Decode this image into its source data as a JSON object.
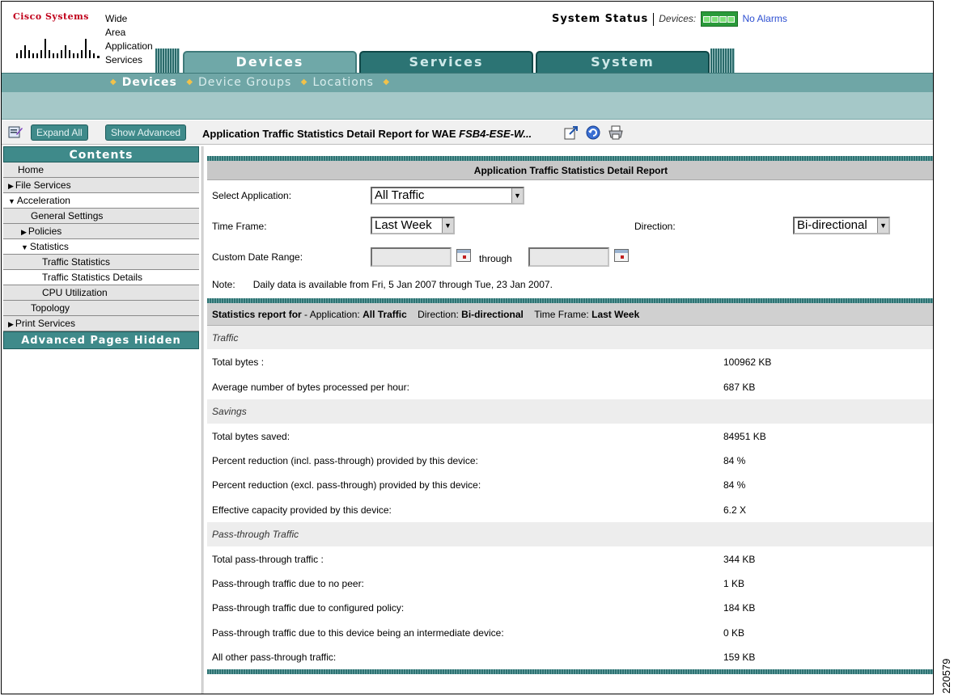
{
  "header": {
    "company": "Cisco Systems",
    "product_lines": [
      "Wide",
      "Area",
      "Application",
      "Services"
    ],
    "system_status_label": "System Status",
    "devices_label": "Devices:",
    "alarms_label": "No Alarms",
    "led_color": "#2a9a3a"
  },
  "tabs": [
    {
      "label": "Devices",
      "active": true
    },
    {
      "label": "Services",
      "active": false
    },
    {
      "label": "System",
      "active": false
    }
  ],
  "subnav": {
    "items": [
      "Devices",
      "Device Groups",
      "Locations"
    ],
    "current": "Devices"
  },
  "toolbar": {
    "expand_all": "Expand All",
    "show_advanced": "Show Advanced",
    "report_title_prefix": "Application Traffic Statistics Detail Report for WAE",
    "report_title_device": "FSB4-ESE-W..."
  },
  "leftnav": {
    "contents": "Contents",
    "items": [
      {
        "label": "Home",
        "indent": 0,
        "tri": "",
        "highlight": false
      },
      {
        "label": "File Services",
        "indent": 0,
        "tri": "▶",
        "highlight": false
      },
      {
        "label": "Acceleration",
        "indent": 0,
        "tri": "▼",
        "highlight": true
      },
      {
        "label": "General Settings",
        "indent": 1,
        "tri": "",
        "highlight": false
      },
      {
        "label": "Policies",
        "indent": 1,
        "tri": "▶",
        "highlight": false
      },
      {
        "label": "Statistics",
        "indent": 1,
        "tri": "▼",
        "highlight": true
      },
      {
        "label": "Traffic Statistics",
        "indent": 2,
        "tri": "",
        "highlight": false
      },
      {
        "label": "Traffic Statistics Details",
        "indent": 2,
        "tri": "",
        "highlight": true
      },
      {
        "label": "CPU Utilization",
        "indent": 2,
        "tri": "",
        "highlight": false
      },
      {
        "label": "Topology",
        "indent": 1,
        "tri": "",
        "highlight": false
      },
      {
        "label": "Print Services",
        "indent": 0,
        "tri": "▶",
        "highlight": false
      }
    ],
    "advanced_hidden": "Advanced Pages Hidden"
  },
  "report": {
    "section_title": "Application Traffic Statistics Detail Report",
    "select_application_label": "Select Application:",
    "select_application_value": "All Traffic",
    "time_frame_label": "Time Frame:",
    "time_frame_value": "Last Week",
    "direction_label": "Direction:",
    "direction_value": "Bi-directional",
    "custom_range_label": "Custom Date Range:",
    "through_label": "through",
    "note_label": "Note:",
    "note_text": "Daily data is available from Fri, 5 Jan 2007 through Tue, 23 Jan 2007."
  },
  "stats": {
    "header_prefix": "Statistics report for",
    "app_label": "- Application:",
    "app_value": "All Traffic",
    "dir_label": "Direction:",
    "dir_value": "Bi-directional",
    "tf_label": "Time Frame:",
    "tf_value": "Last Week",
    "rows": [
      {
        "type": "cat",
        "label": "Traffic",
        "value": ""
      },
      {
        "type": "row",
        "label": "Total bytes :",
        "value": "100962 KB"
      },
      {
        "type": "row",
        "label": "Average number of bytes processed per hour:",
        "value": "687 KB"
      },
      {
        "type": "cat",
        "label": "Savings",
        "value": ""
      },
      {
        "type": "row",
        "label": "Total bytes saved:",
        "value": "84951 KB"
      },
      {
        "type": "row",
        "label": "Percent reduction (incl. pass-through) provided by this device:",
        "value": "84 %"
      },
      {
        "type": "row",
        "label": "Percent reduction (excl. pass-through) provided by this device:",
        "value": "84 %"
      },
      {
        "type": "row",
        "label": "Effective capacity provided by this device:",
        "value": "6.2 X"
      },
      {
        "type": "cat",
        "label": "Pass-through Traffic",
        "value": ""
      },
      {
        "type": "row",
        "label": "Total pass-through traffic :",
        "value": "344 KB"
      },
      {
        "type": "row",
        "label": "Pass-through traffic due to no peer:",
        "value": "1 KB"
      },
      {
        "type": "row",
        "label": "Pass-through traffic due to configured policy:",
        "value": "184 KB"
      },
      {
        "type": "row",
        "label": "Pass-through traffic due to this device being an intermediate device:",
        "value": "0 KB"
      },
      {
        "type": "row",
        "label": "All other pass-through traffic:",
        "value": "159 KB"
      }
    ]
  },
  "figure_id": "220579"
}
